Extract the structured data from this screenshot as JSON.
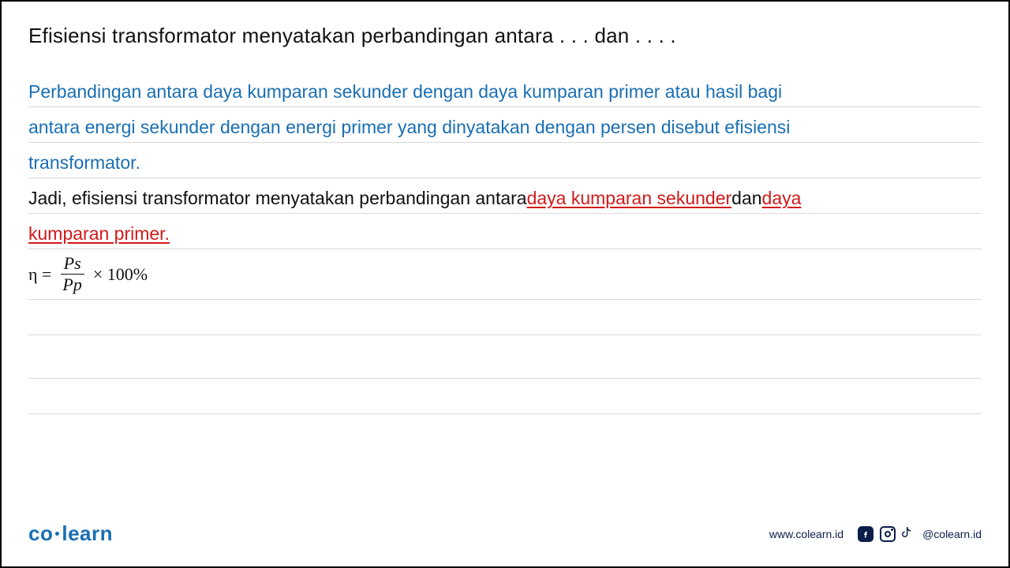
{
  "question": "Efisiensi transformator menyatakan perbandingan antara . . . dan . . . .",
  "explanation": {
    "line1": "Perbandingan antara daya kumparan sekunder dengan daya kumparan primer atau hasil bagi",
    "line2": "antara energi sekunder dengan energi primer yang dinyatakan dengan persen disebut efisiensi",
    "line3": "transformator."
  },
  "conclusion": {
    "line1_pre": "Jadi, efisiensi transformator menyatakan perbandingan antara",
    "line1_answer1": " daya kumparan sekunder",
    "line1_mid": " dan",
    "line1_answer2": " daya",
    "line2_answer_cont": "kumparan primer."
  },
  "formula": {
    "lhs": "η =",
    "numerator": "Ps",
    "denominator": "Pp",
    "rhs": "× 100%"
  },
  "brand": {
    "part1": "co",
    "part2": "learn"
  },
  "footer": {
    "url": "www.colearn.id",
    "handle": "@colearn.id"
  }
}
